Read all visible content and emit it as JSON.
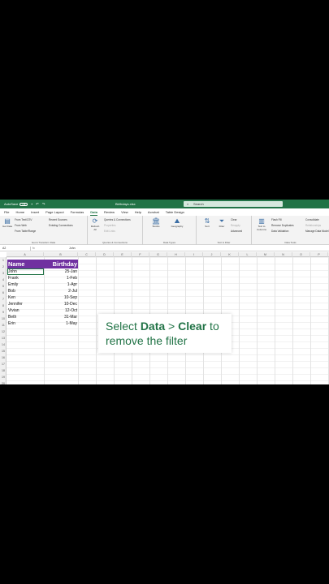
{
  "titlebar": {
    "autosave_label": "AutoSave",
    "autosave_state": "Off",
    "doc_title": "Birthdays.xlsx",
    "search_placeholder": "Search"
  },
  "tabs": [
    "File",
    "Home",
    "Insert",
    "Page Layout",
    "Formulas",
    "Data",
    "Review",
    "View",
    "Help",
    "Acrobat",
    "Table Design"
  ],
  "active_tab": "Data",
  "ribbon": {
    "get_data": "Get Data",
    "from_text": "From Text/CSV",
    "from_web": "From Web",
    "from_table": "From Table/Range",
    "recent_sources": "Recent Sources",
    "existing_conn": "Existing Connections",
    "group1_label": "Get & Transform Data",
    "refresh_all": "Refresh All",
    "queries_conn": "Queries & Connections",
    "properties": "Properties",
    "edit_links": "Edit Links",
    "group2_label": "Queries & Connections",
    "stocks": "Stocks",
    "geography": "Geography",
    "group3_label": "Data Types",
    "sort": "Sort",
    "filter": "Filter",
    "clear": "Clear",
    "reapply": "Reapply",
    "advanced": "Advanced",
    "group4_label": "Sort & Filter",
    "text_to_columns": "Text to Columns",
    "flash_fill": "Flash Fill",
    "remove_duplicates": "Remove Duplicates",
    "data_validation": "Data Validation",
    "consolidate": "Consolidate",
    "relationships": "Relationships",
    "manage_data_model": "Manage Data Model",
    "group5_label": "Data Tools"
  },
  "formula_bar": {
    "name_box": "A2",
    "fx": "fx",
    "value": "John"
  },
  "columns": [
    "A",
    "B",
    "C",
    "D",
    "E",
    "F",
    "G",
    "H",
    "I",
    "J",
    "K",
    "L",
    "M",
    "N",
    "O",
    "P"
  ],
  "rows": [
    "1",
    "2",
    "3",
    "4",
    "5",
    "6",
    "7",
    "8",
    "9",
    "10",
    "11",
    "12",
    "13",
    "14",
    "15",
    "16",
    "17",
    "18",
    "19",
    "20"
  ],
  "table": {
    "header_name": "Name",
    "header_birthday": "Birthday",
    "records": [
      {
        "name": "John",
        "birthday": "25-Jan"
      },
      {
        "name": "Frank",
        "birthday": "1-Feb"
      },
      {
        "name": "Emily",
        "birthday": "1-Apr"
      },
      {
        "name": "Bob",
        "birthday": "2-Jul"
      },
      {
        "name": "Ken",
        "birthday": "10-Sep"
      },
      {
        "name": "Jennifer",
        "birthday": "10-Dec"
      },
      {
        "name": "Vivian",
        "birthday": "12-Oct"
      },
      {
        "name": "Beth",
        "birthday": "31-Mar"
      },
      {
        "name": "Erin",
        "birthday": "1-May"
      }
    ]
  },
  "callout": {
    "line1_prefix": "Select ",
    "data_word": "Data",
    "sep": " > ",
    "clear_word": "Clear",
    "line1_suffix": " to",
    "line2": "remove the filter"
  },
  "colors": {
    "excel_green": "#217346",
    "header_purple": "#7030a0"
  }
}
